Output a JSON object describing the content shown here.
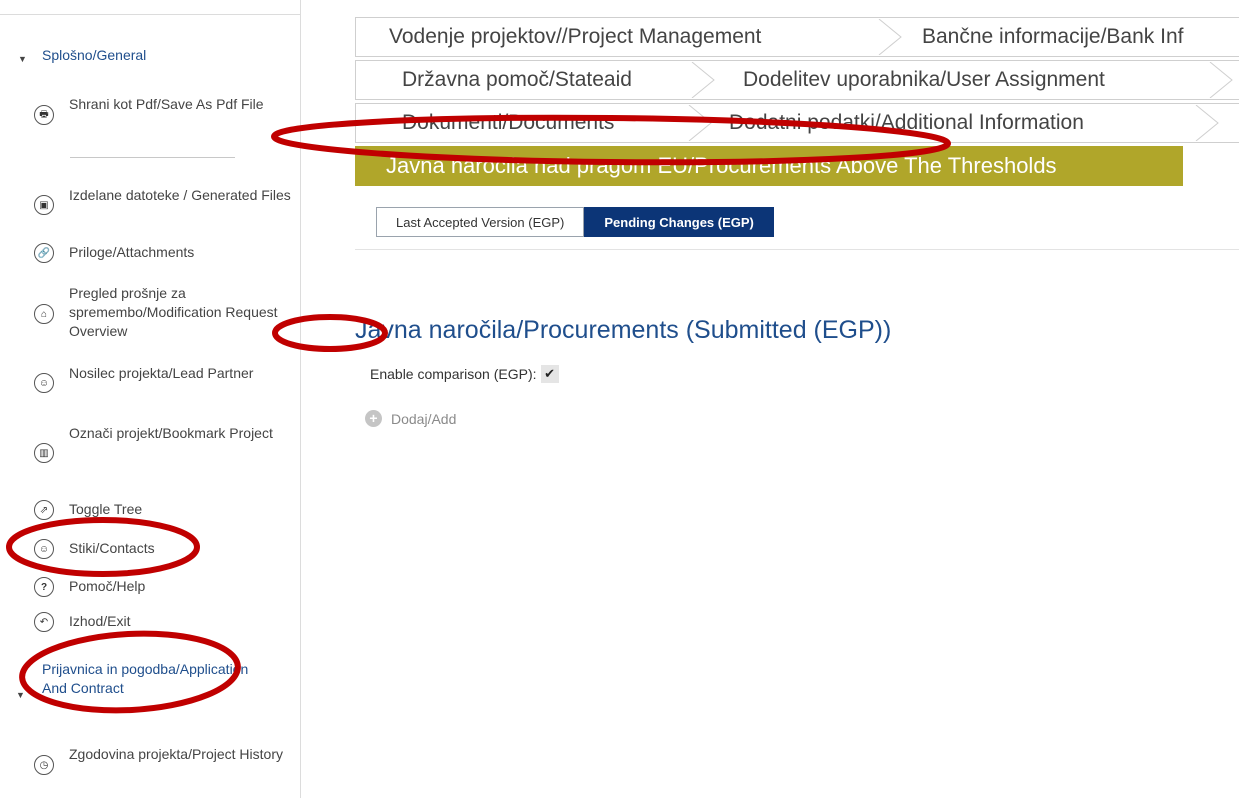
{
  "sidebar": {
    "general_section": "Splošno/General",
    "items": [
      {
        "label": "Shrani kot Pdf/Save As Pdf File",
        "icon": "print-icon"
      },
      {
        "label": "Izdelane datoteke / Generated Files",
        "icon": "save-icon"
      },
      {
        "label": "Priloge/Attachments",
        "icon": "paperclip-icon"
      },
      {
        "label": "Pregled prošnje za spremembo/Modification Request Overview",
        "icon": "institution-icon"
      },
      {
        "label": "Nosilec projekta/Lead Partner",
        "icon": "user-icon"
      },
      {
        "label": "Označi projekt/Bookmark Project",
        "icon": "bookmark-icon"
      },
      {
        "label": "Toggle Tree",
        "icon": "external-link-icon"
      },
      {
        "label": "Stiki/Contacts",
        "icon": "contacts-icon"
      },
      {
        "label": "Pomoč/Help",
        "icon": "help-icon"
      },
      {
        "label": "Izhod/Exit",
        "icon": "exit-icon"
      }
    ],
    "application_section": "Prijavnica in pogodba/Application And Contract",
    "history_item": {
      "label": "Zgodovina projekta/Project History",
      "icon": "history-icon"
    }
  },
  "tabs": {
    "row1": [
      "Vodenje projektov//Project Management",
      "Bančne informacije/Bank Inf"
    ],
    "row2": [
      "Državna pomoč/Stateaid",
      "Dodelitev uporabnika/User Assignment"
    ],
    "row3": [
      "Dokumenti/Documents",
      "Dodatni podatki/Additional Information"
    ],
    "active": "Javna naročila nad pragom EU/Procurements Above The Thresholds"
  },
  "subtabs": {
    "last_accepted": "Last Accepted Version (EGP)",
    "pending": "Pending Changes (EGP)"
  },
  "main": {
    "title": "Javna naročila/Procurements (Submitted (EGP))",
    "compare_label": "Enable comparison (EGP):",
    "compare_check": "✔",
    "add_label": "Dodaj/Add"
  },
  "colors": {
    "accent_olive": "#b0a62a",
    "active_blue": "#0c3577",
    "title_blue": "#1f4e8c",
    "annotation_red": "#c00000"
  }
}
